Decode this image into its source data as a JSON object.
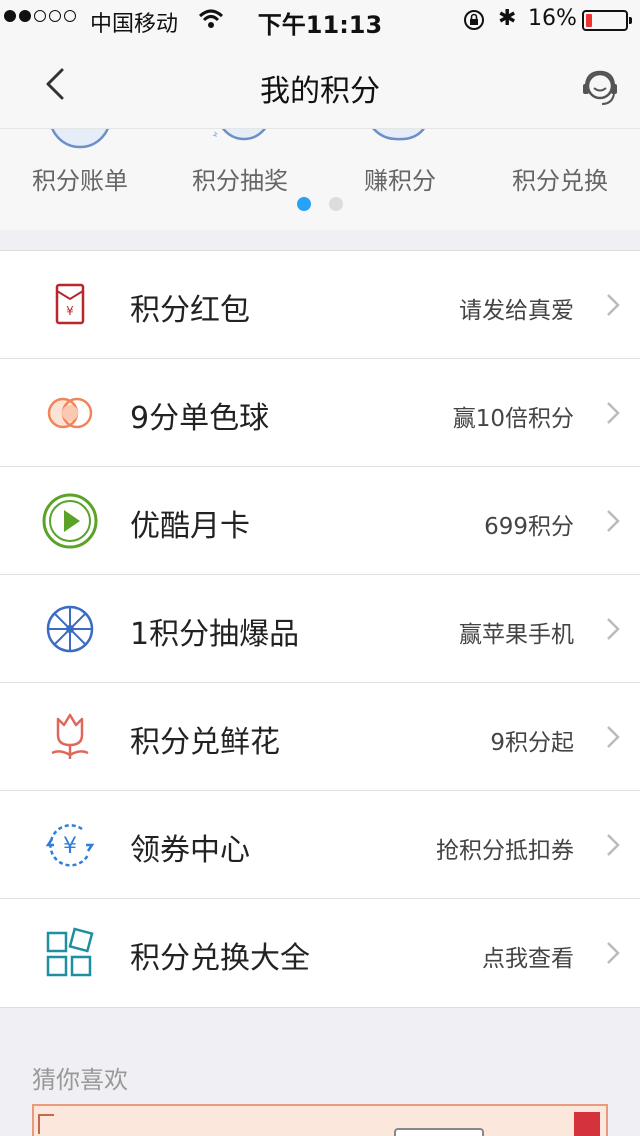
{
  "status_bar": {
    "carrier": "中国移动",
    "time": "下午11:13",
    "battery_pct": "16%",
    "battery_level": 0.16
  },
  "nav": {
    "title": "我的积分",
    "back_icon": "chevron-left-icon",
    "service_icon": "customer-service-icon"
  },
  "shortcuts": [
    {
      "label": "积分账单",
      "icon": "bill-icon"
    },
    {
      "label": "积分抽奖",
      "icon": "lottery-icon"
    },
    {
      "label": "赚积分",
      "icon": "earn-icon"
    },
    {
      "label": "积分兑换",
      "icon": "gift-box-icon"
    }
  ],
  "pager": {
    "count": 2,
    "active": 0
  },
  "list": [
    {
      "title": "积分红包",
      "sub": "请发给真爱",
      "icon": "red-envelope-icon",
      "color": "#b8272d"
    },
    {
      "title": "9分单色球",
      "sub": "赢10倍积分",
      "icon": "lottery-balls-icon",
      "color": "#f0845a"
    },
    {
      "title": "优酷月卡",
      "sub": "699积分",
      "icon": "play-circle-icon",
      "color": "#5aa228"
    },
    {
      "title": "1积分抽爆品",
      "sub": "赢苹果手机",
      "icon": "wheel-icon",
      "color": "#3b6cc4"
    },
    {
      "title": "积分兑鲜花",
      "sub": "9积分起",
      "icon": "flower-icon",
      "color": "#e0685b"
    },
    {
      "title": "领券中心",
      "sub": "抢积分抵扣券",
      "icon": "coupon-yuan-icon",
      "color": "#2f7fd8"
    },
    {
      "title": "积分兑换大全",
      "sub": "点我查看",
      "icon": "grid-apps-icon",
      "color": "#1f8fa0"
    }
  ],
  "guess": {
    "title": "猜你喜欢"
  }
}
